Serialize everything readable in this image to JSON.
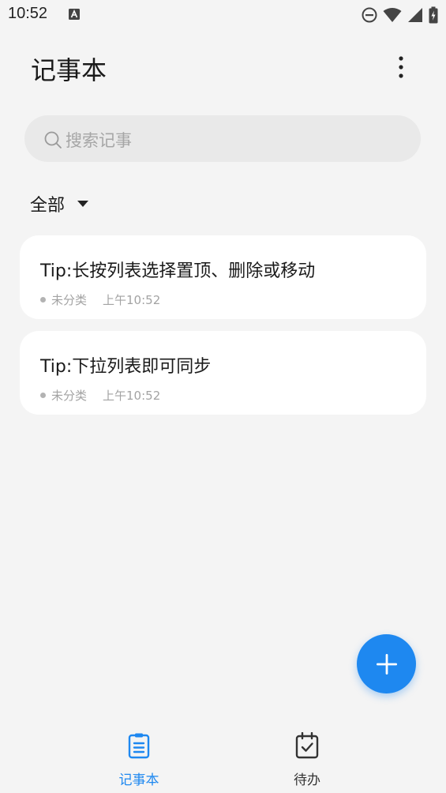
{
  "status_bar": {
    "time": "10:52",
    "icons": [
      "accessibility-a-icon",
      "do-not-disturb-icon",
      "wifi-icon",
      "cell-signal-icon",
      "battery-icon"
    ]
  },
  "header": {
    "title": "记事本",
    "menu_icon": "more-vertical-icon"
  },
  "search": {
    "placeholder": "搜索记事",
    "icon": "search-icon"
  },
  "filter": {
    "label": "全部"
  },
  "notes": [
    {
      "title": "Tip:长按列表选择置顶、删除或移动",
      "category": "未分类",
      "time": "上午10:52"
    },
    {
      "title": "Tip:下拉列表即可同步",
      "category": "未分类",
      "time": "上午10:52"
    }
  ],
  "fab": {
    "icon": "plus-icon"
  },
  "bottom_nav": {
    "items": [
      {
        "label": "记事本",
        "icon": "notepad-icon",
        "active": true
      },
      {
        "label": "待办",
        "icon": "calendar-check-icon",
        "active": false
      }
    ]
  },
  "colors": {
    "accent": "#1e88f0",
    "background": "#f4f4f4",
    "card": "#ffffff",
    "search_bg": "#e9e9e9"
  }
}
